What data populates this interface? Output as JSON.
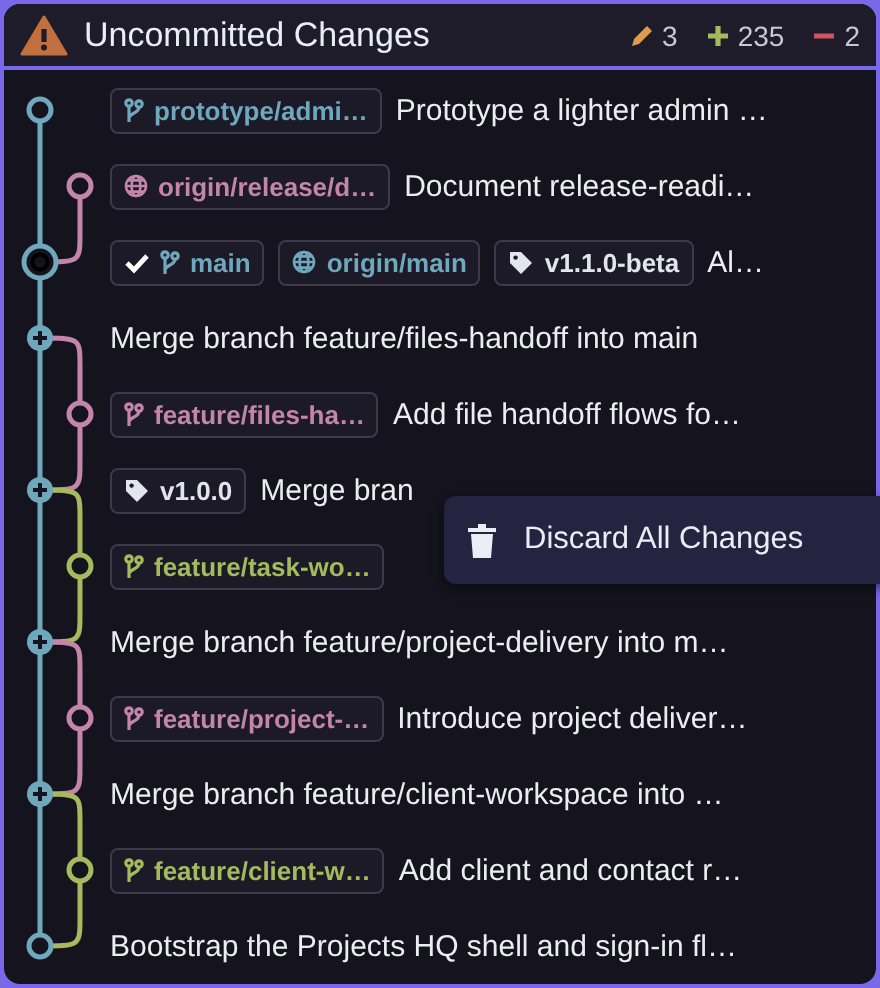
{
  "header": {
    "title": "Uncommitted Changes",
    "modified": "3",
    "added": "235",
    "removed": "2"
  },
  "commits": [
    {
      "kind": "main",
      "merge": false,
      "head": false,
      "color": "#6fa8bd",
      "refs": [
        {
          "kind": "branch",
          "label": "prototype/admi…",
          "color": "#6fa8bd",
          "checked": false
        }
      ],
      "message": "Prototype a lighter admin …"
    },
    {
      "kind": "side",
      "merge": false,
      "head": false,
      "color": "#c385ab",
      "refs": [
        {
          "kind": "remote",
          "label": "origin/release/d…",
          "color": "#c385ab",
          "checked": false
        }
      ],
      "message": "Document release-readi…"
    },
    {
      "kind": "main",
      "merge": false,
      "head": true,
      "color": "#6fa8bd",
      "refs": [
        {
          "kind": "branch",
          "label": "main",
          "color": "#6fa8bd",
          "checked": true
        },
        {
          "kind": "remote",
          "label": "origin/main",
          "color": "#6fa8bd",
          "checked": false
        },
        {
          "kind": "tag",
          "label": "v1.1.0-beta",
          "color": "#e4e4ec",
          "checked": false
        }
      ],
      "message": "Al…"
    },
    {
      "kind": "main",
      "merge": true,
      "head": false,
      "color": "#6fa8bd",
      "message": "Merge branch feature/files-handoff into main"
    },
    {
      "kind": "side",
      "merge": false,
      "head": false,
      "color": "#c385ab",
      "refs": [
        {
          "kind": "branch",
          "label": "feature/files-ha…",
          "color": "#c385ab",
          "checked": false
        }
      ],
      "message": "Add file handoff flows fo…"
    },
    {
      "kind": "main",
      "merge": true,
      "head": false,
      "color": "#6fa8bd",
      "refs": [
        {
          "kind": "tag",
          "label": "v1.0.0",
          "color": "#e4e4ec",
          "checked": false
        }
      ],
      "message": "Merge bran"
    },
    {
      "kind": "side",
      "merge": false,
      "head": false,
      "color": "#a8b85c",
      "refs": [
        {
          "kind": "branch",
          "label": "feature/task-wo…",
          "color": "#a8b85c",
          "checked": false
        }
      ]
    },
    {
      "kind": "main",
      "merge": true,
      "head": false,
      "color": "#6fa8bd",
      "message": "Merge branch feature/project-delivery into m…"
    },
    {
      "kind": "side",
      "merge": false,
      "head": false,
      "color": "#c385ab",
      "refs": [
        {
          "kind": "branch",
          "label": "feature/project-…",
          "color": "#c385ab",
          "checked": false
        }
      ],
      "message": "Introduce project deliver…"
    },
    {
      "kind": "main",
      "merge": true,
      "head": false,
      "color": "#6fa8bd",
      "message": "Merge branch feature/client-workspace into …"
    },
    {
      "kind": "side",
      "merge": false,
      "head": false,
      "color": "#a8b85c",
      "refs": [
        {
          "kind": "branch",
          "label": "feature/client-w…",
          "color": "#a8b85c",
          "checked": false
        }
      ],
      "message": "Add client and contact r…"
    },
    {
      "kind": "main",
      "merge": false,
      "head": false,
      "color": "#6fa8bd",
      "message": "Bootstrap the Projects HQ shell and sign-in fl…"
    }
  ],
  "context_menu": {
    "items": [
      {
        "label": "Discard All Changes"
      }
    ]
  }
}
